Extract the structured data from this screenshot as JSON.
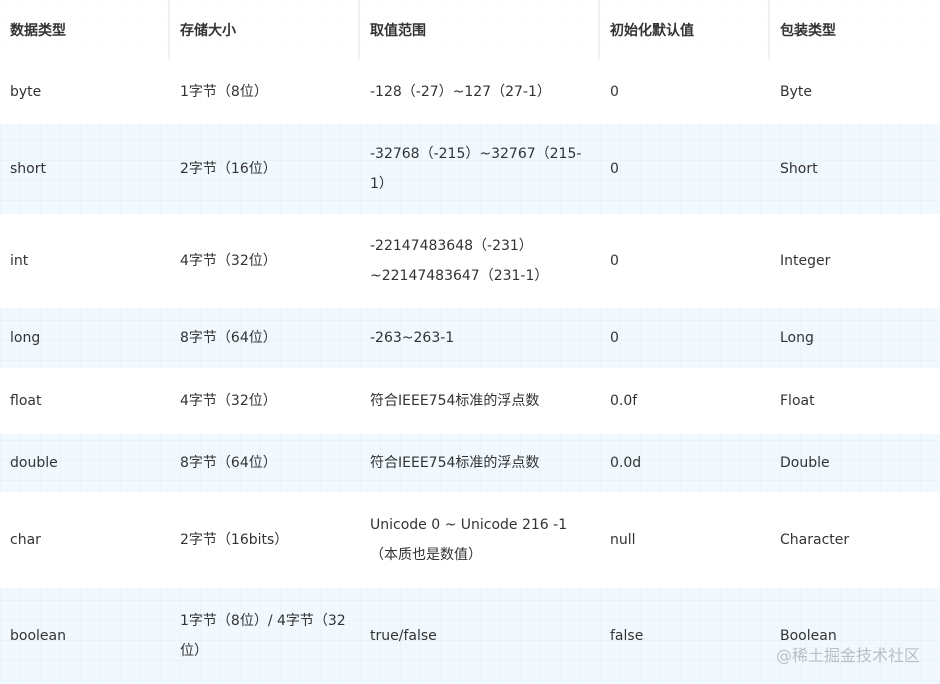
{
  "table": {
    "headers": [
      "数据类型",
      "存储大小",
      "取值范围",
      "初始化默认值",
      "包装类型"
    ],
    "rows": [
      [
        "byte",
        "1字节（8位）",
        "-128（-27）~127（27-1）",
        "0",
        "Byte"
      ],
      [
        "short",
        "2字节（16位）",
        "-32768（-215）~32767（215-1）",
        "0",
        "Short"
      ],
      [
        "int",
        "4字节（32位）",
        "-22147483648（-231）~22147483647（231-1）",
        "0",
        "Integer"
      ],
      [
        "long",
        "8字节（64位）",
        "-263~263-1",
        "0",
        "Long"
      ],
      [
        "float",
        "4字节（32位）",
        "符合IEEE754标准的浮点数",
        "0.0f",
        "Float"
      ],
      [
        "double",
        "8字节（64位）",
        "符合IEEE754标准的浮点数",
        "0.0d",
        "Double"
      ],
      [
        "char",
        "2字节（16bits）",
        "Unicode 0 ~ Unicode 216 -1（本质也是数值）",
        "null",
        "Character"
      ],
      [
        "boolean",
        "1字节（8位）/ 4字节（32位）",
        "true/false",
        "false",
        "Boolean"
      ]
    ]
  },
  "watermark": "@稀土掘金技术社区"
}
